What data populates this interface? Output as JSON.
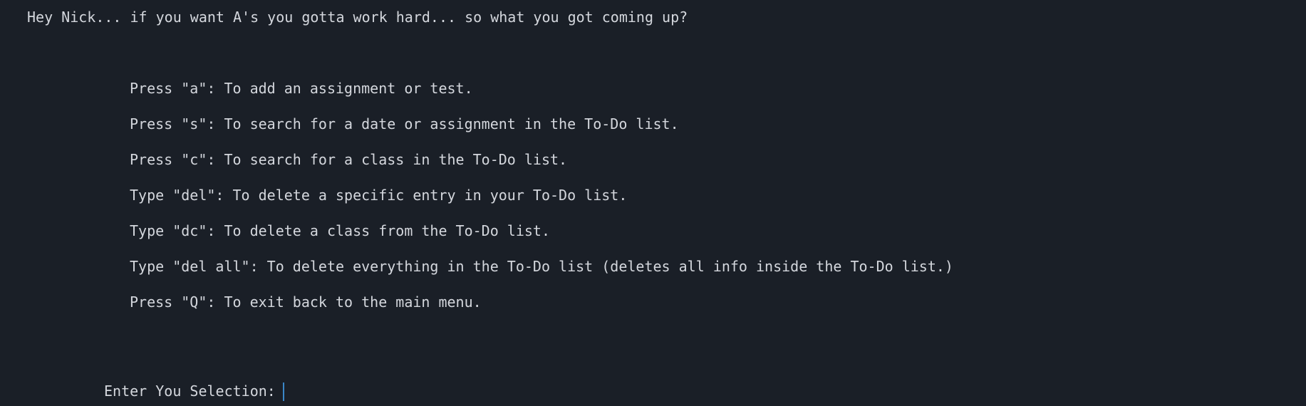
{
  "terminal": {
    "greeting": "Hey Nick... if you want A's you gotta work hard... so what you got coming up?",
    "menu": [
      {
        "text": "Press \"a\": To add an assignment or test."
      },
      {
        "text": "Press \"s\": To search for a date or assignment in the To-Do list."
      },
      {
        "text": "Press \"c\": To search for a class in the To-Do list."
      },
      {
        "text": "Type \"del\": To delete a specific entry in your To-Do list."
      },
      {
        "text": "Type \"dc\": To delete a class from the To-Do list."
      },
      {
        "text": "Type \"del all\": To delete everything in the To-Do list (deletes all info inside the To-Do list.)"
      },
      {
        "text": "Press \"Q\": To exit back to the main menu."
      }
    ],
    "prompt": "Enter You Selection:",
    "input_value": ""
  },
  "colors": {
    "background": "#1a1f27",
    "text": "#d4d7dd",
    "cursor": "#3a86c8"
  }
}
